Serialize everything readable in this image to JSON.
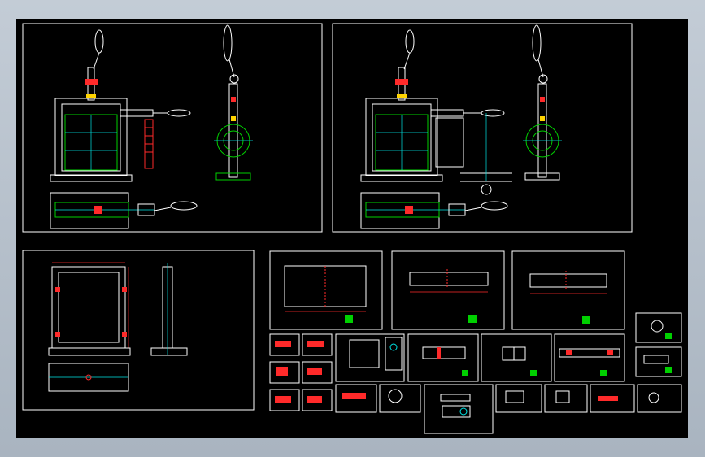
{
  "app": {
    "title": ""
  },
  "drawing": {
    "background": "#000000",
    "colors": {
      "frame": "#ffffff",
      "part": "#ffffff",
      "dimension": "#ff2a2a",
      "centerline": "#00e5e5",
      "hidden": "#00d000",
      "accent": "#ffd400",
      "hatch": "#ff3cff"
    },
    "sheets": [
      {
        "id": "assembly-front-left",
        "kind": "assembly"
      },
      {
        "id": "assembly-front-right",
        "kind": "assembly"
      },
      {
        "id": "frame-detail",
        "kind": "frame"
      },
      {
        "id": "plate-detail-1",
        "kind": "detail"
      },
      {
        "id": "plate-detail-2",
        "kind": "detail"
      },
      {
        "id": "plate-detail-3",
        "kind": "detail"
      }
    ],
    "small_detail_count": 20
  }
}
